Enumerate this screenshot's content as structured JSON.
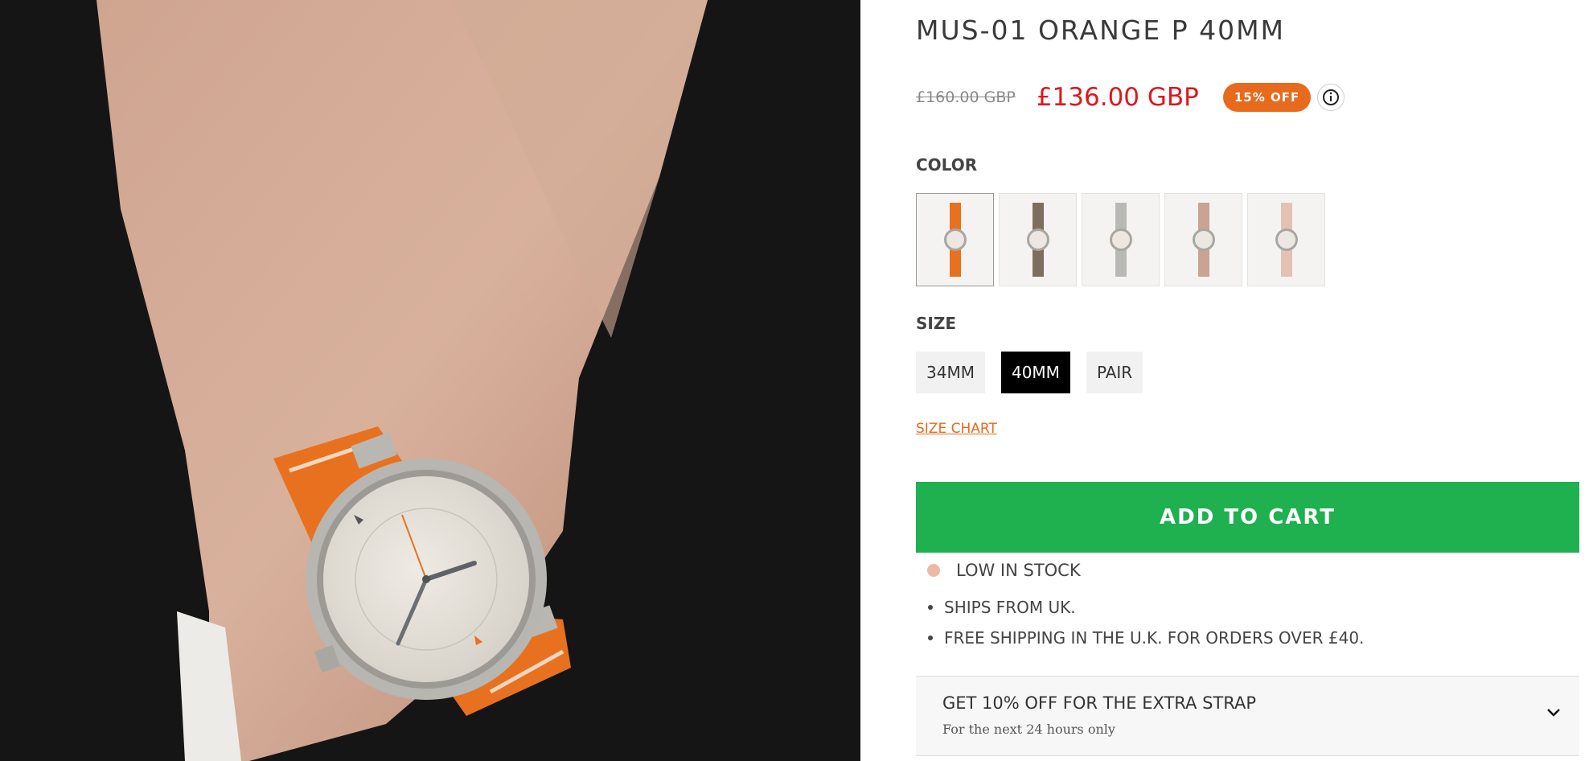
{
  "product": {
    "title": "MUS-01 ORANGE P 40MM",
    "original_price": "£160.00 GBP",
    "sale_price": "£136.00 GBP",
    "discount_badge": "15% OFF"
  },
  "color_section": {
    "label": "COLOR",
    "swatches": [
      {
        "strap_color": "#e8711f",
        "selected": true
      },
      {
        "strap_color": "#7d6f5f",
        "selected": false
      },
      {
        "strap_color": "#b8b9b4",
        "selected": false
      },
      {
        "strap_color": "#c9a394",
        "selected": false
      },
      {
        "strap_color": "#e3c2b4",
        "selected": false
      }
    ]
  },
  "size_section": {
    "label": "SIZE",
    "options": [
      "34MM",
      "40MM",
      "PAIR"
    ],
    "selected": "40MM",
    "size_chart_link": "SIZE CHART"
  },
  "cart": {
    "button_label": "ADD TO CART"
  },
  "stock": {
    "status": "LOW IN STOCK",
    "dot_color": "#efb8a6"
  },
  "shipping_notes": [
    "SHIPS FROM UK.",
    "FREE SHIPPING IN THE U.K. FOR ORDERS OVER £40."
  ],
  "offer": {
    "title": "GET 10% OFF FOR THE EXTRA STRAP",
    "subtitle": "For the next 24 hours only"
  },
  "colors": {
    "accent_orange": "#e86a1d",
    "sale_red": "#e0171e",
    "cart_green": "#1fb04f"
  },
  "icons": [
    "info-icon",
    "chevron-down-icon"
  ]
}
